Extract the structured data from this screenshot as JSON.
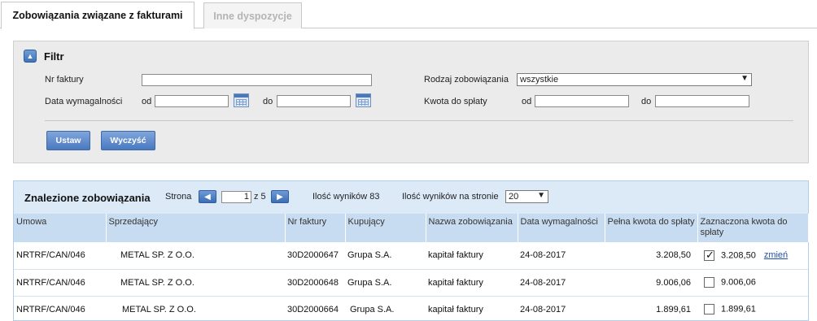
{
  "tabs": [
    {
      "label": "Zobowiązania związane z fakturami"
    },
    {
      "label": "Inne dyspozycje"
    }
  ],
  "filter": {
    "title": "Filtr",
    "nr_faktury_label": "Nr faktury",
    "nr_faktury_value": "",
    "data_label": "Data wymagalności",
    "od_label": "od",
    "do_label": "do",
    "rodzaj_label": "Rodzaj zobowiązania",
    "rodzaj_value": "wszystkie",
    "kwota_label": "Kwota do spłaty",
    "set_button": "Ustaw",
    "clear_button": "Wyczyść"
  },
  "results": {
    "title": "Znalezione zobowiązania",
    "page_label": "Strona",
    "page_value": "1",
    "page_of": "z 5",
    "count_text": "Ilość wyników 83",
    "per_page_label": "Ilość wyników na stronie",
    "per_page_value": "20",
    "columns": [
      "Umowa",
      "Sprzedający",
      "Nr faktury",
      "Kupujący",
      "Nazwa zobowiązania",
      "Data wymagalności",
      "Pełna kwota do spłaty",
      "Zaznaczona kwota do spłaty"
    ],
    "rows": [
      {
        "umowa": "NRTRF/CAN/046",
        "sprzedajacy": "METAL SP. Z O.O.",
        "nr": "30D2000647",
        "kupujacy": "Grupa S.A.",
        "nazwa": "kapitał faktury",
        "data": "24-08-2017",
        "pelna": "3.208,50",
        "checked": true,
        "zaznaczona": "3.208,50",
        "link": "zmień"
      },
      {
        "umowa": "NRTRF/CAN/046",
        "sprzedajacy": "METAL SP. Z O.O.",
        "nr": "30D2000648",
        "kupujacy": "Grupa S.A.",
        "nazwa": "kapitał faktury",
        "data": "24-08-2017",
        "pelna": "9.006,06",
        "checked": false,
        "zaznaczona": "9.006,06",
        "link": ""
      },
      {
        "umowa": "NRTRF/CAN/046",
        "sprzedajacy": "METAL SP. Z O.O.",
        "nr": "30D2000664",
        "kupujacy": "Grupa S.A.",
        "nazwa": "kapitał faktury",
        "data": "24-08-2017",
        "pelna": "1.899,61",
        "checked": false,
        "zaznaczona": "1.899,61",
        "link": ""
      }
    ]
  },
  "icons": {
    "collapse": "chevron-up-icon",
    "calendar": "calendar-icon",
    "prev": "chevron-left-icon",
    "next": "chevron-right-icon"
  },
  "colors": {
    "accent": "#4a79bf",
    "panel_header": "#dceaf8",
    "table_header": "#c8dcf1",
    "link": "#1f4fa8"
  }
}
